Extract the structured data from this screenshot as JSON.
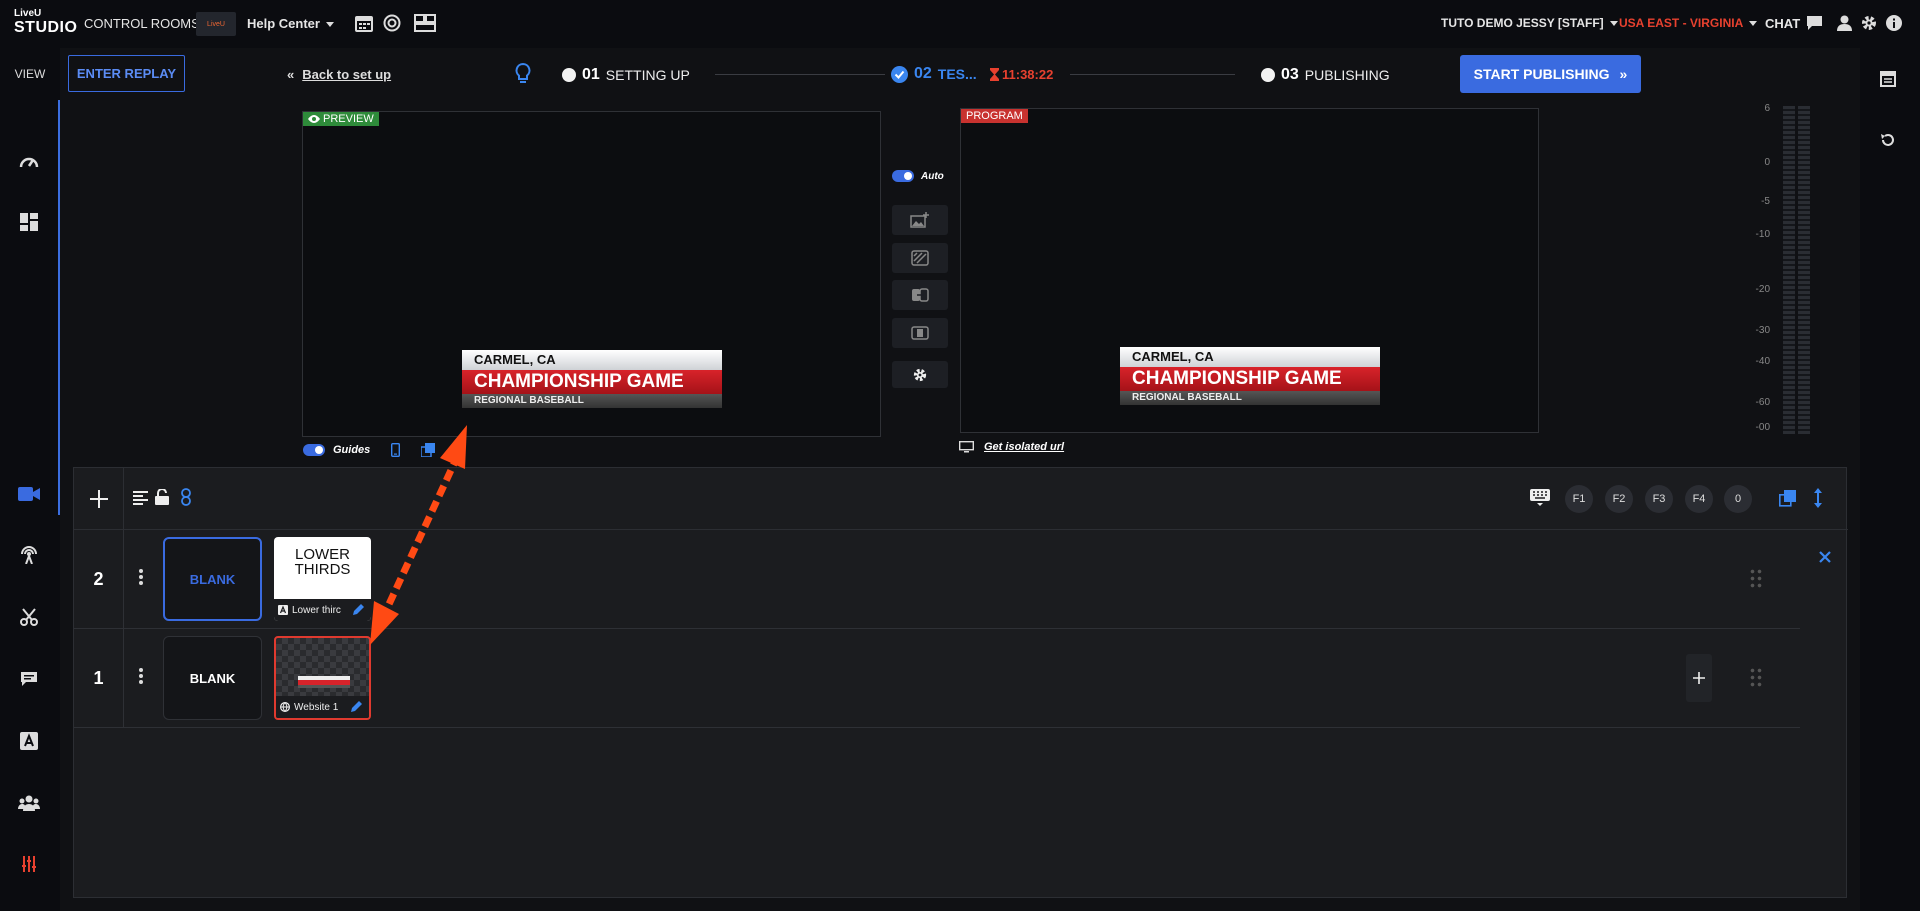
{
  "app": {
    "logo_line1": "LiveU",
    "logo_line2": "STUDIO",
    "nav_control_rooms": "CONTROL ROOMS",
    "room_thumb_text": "LiveU",
    "room_name": "Help Center",
    "user": "TUTO DEMO JESSY [STAFF]",
    "region": "USA EAST - VIRGINIA",
    "chat": "CHAT",
    "region_color": "#e8412f",
    "accent_color": "#3a6be0"
  },
  "sidebar": {
    "view_label": "VIEW",
    "icons": [
      "dashboard-icon",
      "layout-icon",
      "camera-icon",
      "broadcast-icon",
      "scissors-icon",
      "chat-icon",
      "text-icon",
      "guests-icon",
      "mixer-icon"
    ]
  },
  "header": {
    "enter_replay": "ENTER REPLAY",
    "back": "Back to set up",
    "steps": [
      {
        "num": "01",
        "label": "SETTING UP"
      },
      {
        "num": "02",
        "label": "TES..."
      },
      {
        "num": "03",
        "label": "PUBLISHING"
      }
    ],
    "timer": "11:38:22",
    "start_publishing": "START PUBLISHING"
  },
  "preview": {
    "tag": "PREVIEW",
    "guides": "Guides",
    "lower_third": {
      "top": "CARMEL, CA",
      "main": "CHAMPIONSHIP GAME",
      "sub": "REGIONAL BASEBALL"
    }
  },
  "program": {
    "tag": "PROGRAM",
    "isolated": "Get isolated url",
    "lower_third": {
      "top": "CARMEL, CA",
      "main": "CHAMPIONSHIP GAME",
      "sub": "REGIONAL BASEBALL"
    }
  },
  "controls": {
    "auto": "Auto"
  },
  "meter": {
    "ticks": [
      "6",
      "0",
      "-5",
      "-10",
      "-20",
      "-30",
      "-40",
      "-60",
      "-00"
    ]
  },
  "layers": {
    "fkeys": [
      "F1",
      "F2",
      "F3",
      "F4",
      "0"
    ],
    "rows": [
      {
        "num": "2",
        "blank": "BLANK",
        "card_title": "LOWER THIRDS",
        "card_label": "Lower thirc"
      },
      {
        "num": "1",
        "blank": "BLANK",
        "card_label": "Website 1"
      }
    ]
  }
}
